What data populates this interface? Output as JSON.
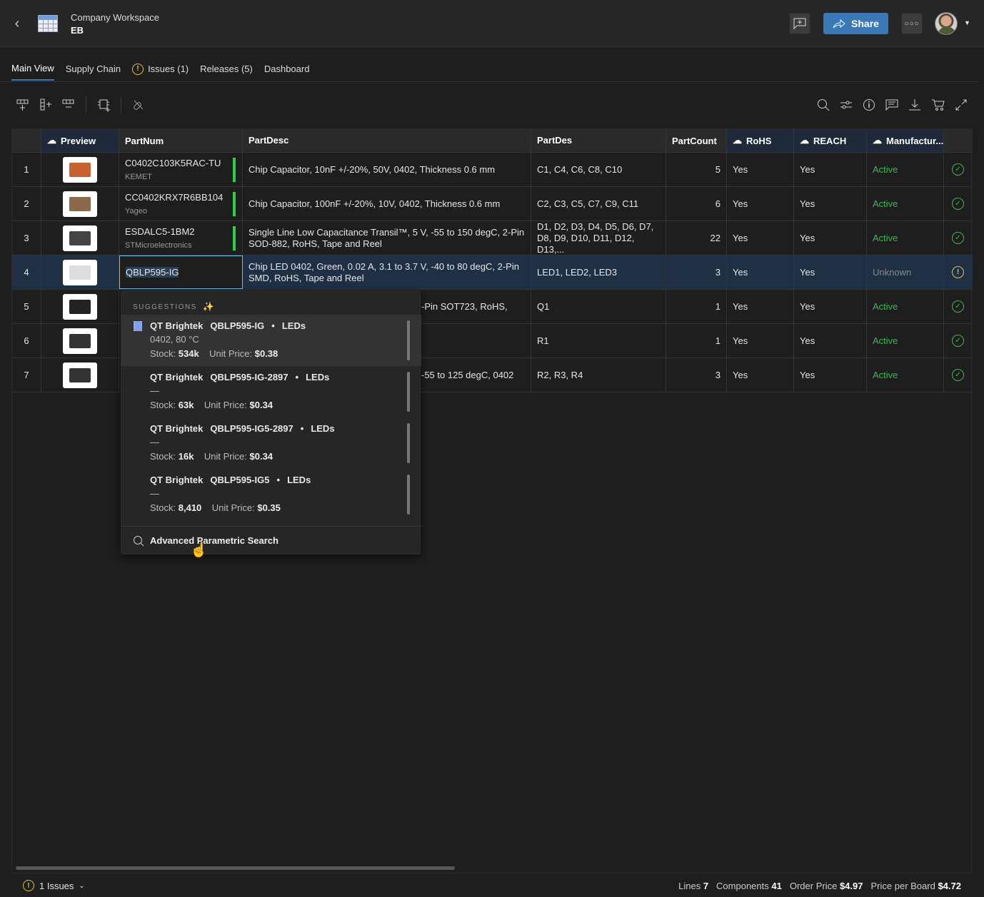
{
  "header": {
    "workspace": "Company Workspace",
    "project": "EB",
    "share_label": "Share"
  },
  "tabs": [
    {
      "label": "Main View"
    },
    {
      "label": "Supply Chain"
    },
    {
      "label": "Issues (1)"
    },
    {
      "label": "Releases (5)"
    },
    {
      "label": "Dashboard"
    }
  ],
  "columns": [
    "Preview",
    "PartNum",
    "PartDesc",
    "PartDes",
    "PartCount",
    "RoHS",
    "REACH",
    "Manufactur..."
  ],
  "rows": [
    {
      "n": "1",
      "part": "C0402C103K5RAC-TU",
      "mfr": "KEMET",
      "desc": "Chip Capacitor, 10nF +/-20%, 50V, 0402, Thickness 0.6 mm",
      "des": "C1, C4, C6, C8, C10",
      "count": "5",
      "rohs": "Yes",
      "reach": "Yes",
      "lifecycle": "Active"
    },
    {
      "n": "2",
      "part": "CC0402KRX7R6BB104",
      "mfr": "Yageo",
      "desc": "Chip Capacitor, 100nF +/-20%, 10V, 0402, Thickness 0.6 mm",
      "des": "C2, C3, C5, C7, C9, C11",
      "count": "6",
      "rohs": "Yes",
      "reach": "Yes",
      "lifecycle": "Active"
    },
    {
      "n": "3",
      "part": "ESDALC5-1BM2",
      "mfr": "STMicroelectronics",
      "desc": "Single Line Low Capacitance Transil™, 5 V, -55 to 150 degC, 2-Pin SOD-882, RoHS, Tape and Reel",
      "des": "D1, D2, D3, D4, D5, D6, D7, D8, D9, D10, D11, D12, D13,...",
      "count": "22",
      "rohs": "Yes",
      "reach": "Yes",
      "lifecycle": "Active"
    },
    {
      "n": "4",
      "part": "QBLP595-IG",
      "mfr": "",
      "desc": "Chip LED 0402, Green, 0.02 A, 3.1 to 3.7 V, -40 to 80 degC, 2-Pin SMD, RoHS, Tape and Reel",
      "des": "LED1, LED2, LED3",
      "count": "3",
      "rohs": "Yes",
      "reach": "Yes",
      "lifecycle": "Unknown"
    },
    {
      "n": "5",
      "part": "",
      "mfr": "",
      "desc": "-Pin SOT723, RoHS,",
      "des": "Q1",
      "count": "1",
      "rohs": "Yes",
      "reach": "Yes",
      "lifecycle": "Active"
    },
    {
      "n": "6",
      "part": "",
      "mfr": "",
      "desc": "",
      "des": "R1",
      "count": "1",
      "rohs": "Yes",
      "reach": "Yes",
      "lifecycle": "Active"
    },
    {
      "n": "7",
      "part": "",
      "mfr": "",
      "desc": "-55 to 125 degC, 0402",
      "des": "R2, R3, R4",
      "count": "3",
      "rohs": "Yes",
      "reach": "Yes",
      "lifecycle": "Active"
    }
  ],
  "suggestions": {
    "title": "SUGGESTIONS",
    "items": [
      {
        "mfr": "QT Brightek",
        "part": "QBLP595-IG",
        "cat": "LEDs",
        "spec": "0402, 80 °C",
        "stock": "534k",
        "price": "$0.38"
      },
      {
        "mfr": "QT Brightek",
        "part": "QBLP595-IG-2897",
        "cat": "LEDs",
        "spec": "—",
        "stock": "63k",
        "price": "$0.34"
      },
      {
        "mfr": "QT Brightek",
        "part": "QBLP595-IG5-2897",
        "cat": "LEDs",
        "spec": "—",
        "stock": "16k",
        "price": "$0.34"
      },
      {
        "mfr": "QT Brightek",
        "part": "QBLP595-IG5",
        "cat": "LEDs",
        "spec": "—",
        "stock": "8,410",
        "price": "$0.35"
      }
    ],
    "stock_label": "Stock:",
    "price_label": "Unit Price:",
    "advanced": "Advanced Parametric Search"
  },
  "footer": {
    "issues": "1 Issues",
    "lines_label": "Lines",
    "lines": "7",
    "components_label": "Components",
    "components": "41",
    "order_label": "Order Price",
    "order": "$4.97",
    "board_label": "Price per Board",
    "board": "$4.72"
  },
  "colors": {
    "accent": "#3a78b8",
    "active": "#2ebd4f",
    "warn": "#e6c229"
  }
}
